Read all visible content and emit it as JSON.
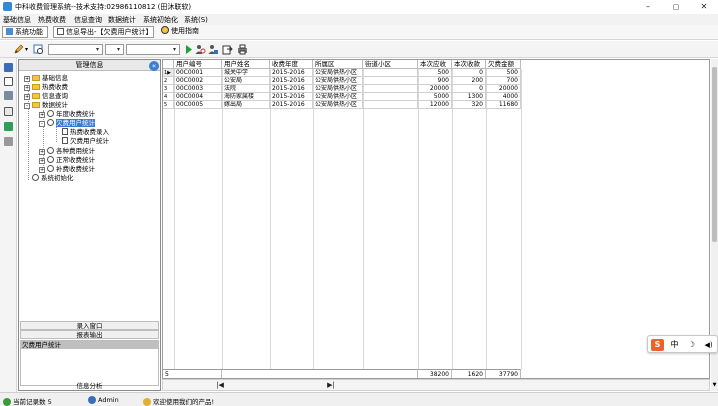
{
  "window": {
    "title": "中科收费管理系统--技术支持:02986110812 (田沐联软)",
    "controls": [
      "–",
      "▢",
      "✕"
    ]
  },
  "menubar": [
    "基础信息",
    "热费收费",
    "信息查询",
    "数据统计",
    "系统初始化",
    "系统(S)"
  ],
  "tabs": [
    {
      "label": "系统功能"
    },
    {
      "label": "信息导出-【欠费用户统计】"
    },
    {
      "label": "使用指南"
    }
  ],
  "tree": {
    "header": "管理信息",
    "nodes": [
      {
        "label": "基础信息",
        "expander": "+"
      },
      {
        "label": "热费收费",
        "expander": "+"
      },
      {
        "label": "信息查询",
        "expander": "+"
      },
      {
        "label": "数据统计",
        "expander": "-"
      },
      {
        "label": "年度收费统计",
        "expander": "+"
      },
      {
        "label": "欠费用户统计",
        "expander": "-"
      },
      {
        "label": "热费收费录入"
      },
      {
        "label": "欠费用户统计"
      },
      {
        "label": "各种费用统计",
        "expander": "+"
      },
      {
        "label": "正常收费统计",
        "expander": "+"
      },
      {
        "label": "补费收费统计",
        "expander": "+"
      },
      {
        "label": "系统初始化"
      }
    ],
    "buttons": [
      "录入窗口",
      "报表输出"
    ],
    "list_selected": "欠费用户统计",
    "bottom_button": "信息分析"
  },
  "grid": {
    "columns": [
      "用户编号",
      "用户姓名",
      "收费年度",
      "所属区",
      "街道小区",
      "本次应收",
      "本次收款",
      "欠费金额"
    ],
    "rows": [
      {
        "idx": "1",
        "marker": "▶",
        "cells": [
          "00C0001",
          "城关中学",
          "2015-2016",
          "公安局供热小区",
          "",
          "500",
          "0",
          "500"
        ]
      },
      {
        "idx": "2",
        "marker": "",
        "cells": [
          "00C0002",
          "公安局",
          "2015-2016",
          "公安局供热小区",
          "",
          "900",
          "200",
          "700"
        ]
      },
      {
        "idx": "3",
        "marker": "",
        "cells": [
          "00C0003",
          "法院",
          "2015-2016",
          "公安局供热小区",
          "",
          "20000",
          "0",
          "20000"
        ]
      },
      {
        "idx": "4",
        "marker": "",
        "cells": [
          "00C0004",
          "海防家属楼",
          "2015-2016",
          "公安局供热小区",
          "",
          "5000",
          "1300",
          "4000"
        ]
      },
      {
        "idx": "5",
        "marker": "",
        "cells": [
          "00C0005",
          "嫁出局",
          "2015-2016",
          "公安局供热小区",
          "",
          "12000",
          "320",
          "11680"
        ]
      }
    ],
    "footer": {
      "count": "5",
      "total_due": "38200",
      "total_paid": "1620",
      "total_owed": "37790"
    }
  },
  "nav": {
    "first": "|◀",
    "last": "▶|"
  },
  "ime": [
    "S",
    "中",
    "☽",
    "◀)"
  ],
  "status": {
    "records": "当前记录数 5",
    "user": "Admin",
    "welcome": "欢迎使用我们的产品!"
  }
}
